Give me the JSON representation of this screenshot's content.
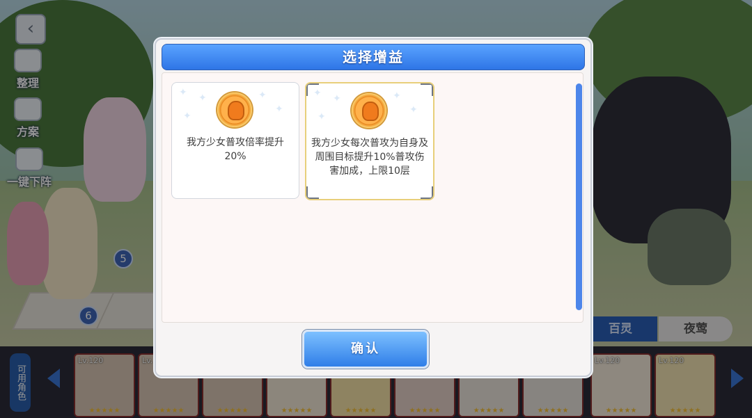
{
  "dialog": {
    "title": "选择增益",
    "confirm_label": "确认",
    "buffs": [
      {
        "text": "我方少女普攻倍率提升20%",
        "icon": "buff-medal-icon",
        "selected": false
      },
      {
        "text": "我方少女每次普攻为自身及周围目标提升10%普攻伤害加成，上限10层",
        "icon": "buff-medal-icon",
        "selected": true
      }
    ]
  },
  "sidebar": {
    "items": [
      {
        "label": "整理",
        "icon": "organize-icon"
      },
      {
        "label": "方案",
        "icon": "plan-book-icon"
      },
      {
        "label": "一键下阵",
        "icon": "dismiss-all-icon"
      }
    ]
  },
  "formation": {
    "slot_numbers": [
      "5",
      "6"
    ]
  },
  "faction_tabs": [
    {
      "label": "百灵",
      "selected": true
    },
    {
      "label": "夜莺",
      "selected": false
    }
  ],
  "roster": {
    "available_label": "可用角色",
    "cards": [
      {
        "level": "Lv.120"
      },
      {
        "level": "Lv."
      },
      {
        "level": ""
      },
      {
        "level": ""
      },
      {
        "level": ""
      },
      {
        "level": ""
      },
      {
        "level": ""
      },
      {
        "level": ""
      },
      {
        "level": "Lv.120"
      },
      {
        "level": "Lv.120"
      }
    ]
  },
  "colors": {
    "header_blue": "#2e75e6",
    "confirm_blue": "#2f7ee8",
    "selected_border": "#e8cf7a",
    "buff_medal": "#f07b1d"
  }
}
